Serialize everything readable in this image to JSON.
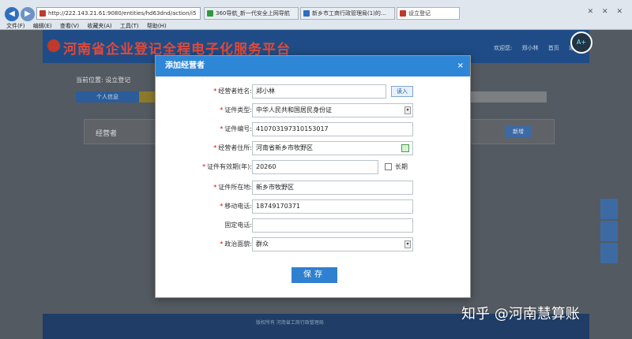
{
  "browser": {
    "address": "http://222.143.21.61:9080/entities/hd63dnd/action/i5",
    "tabs": [
      {
        "label": "360导航_新一代安全上网导航",
        "color": "#2e9b3a"
      },
      {
        "label": "新乡市工商行政管理局(1)的... ",
        "color": "#2e6fbf"
      },
      {
        "label": "设立登记",
        "color": "#c0392b"
      }
    ],
    "controls": "✕ ✕ ✕",
    "menu": [
      "文件(F)",
      "编辑(E)",
      "查看(V)",
      "收藏夹(A)",
      "工具(T)",
      "帮助(H)"
    ]
  },
  "site": {
    "title": "河南省企业登记全程电子化服务平台",
    "header_links": "欢迎您: 郑小林 首页 退出",
    "breadcrumb": "当前位置: 设立登记",
    "step1": "个人信息",
    "panel_label": "经营者",
    "panel_button": "新增",
    "footer": "版权所有 河南省工商行政管理局",
    "badge": "A+"
  },
  "modal": {
    "title": "添加经营者",
    "close": "×",
    "fields": [
      {
        "label": "经营者姓名:",
        "required": true,
        "value": "郑小林"
      },
      {
        "label": "证件类型:",
        "required": true,
        "value": "中华人民共和国居民身份证"
      },
      {
        "label": "证件编号:",
        "required": true,
        "value": "410703197310153017"
      },
      {
        "label": "经营者住所:",
        "required": true,
        "value": "河南省新乡市牧野区"
      },
      {
        "label": "证件有效期(年):",
        "required": true,
        "value": "20260"
      },
      {
        "label": "证件所在地:",
        "required": true,
        "value": "新乡市牧野区"
      },
      {
        "label": "移动电话:",
        "required": true,
        "value": "18749170371"
      },
      {
        "label": "固定电话:",
        "required": false,
        "value": ""
      },
      {
        "label": "政治面貌:",
        "required": true,
        "value": "群众"
      }
    ],
    "read_button": "读入",
    "long_term_label": "长期",
    "save_button": "保存"
  },
  "watermark": "知乎 @河南慧算账",
  "colors": {
    "modal_header": "#2e86d7",
    "save": "#2f80d0",
    "required": "#dd0000"
  }
}
